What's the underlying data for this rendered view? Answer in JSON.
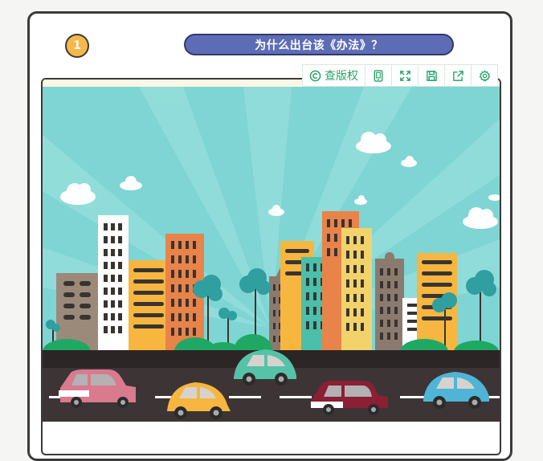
{
  "step": {
    "number": "1"
  },
  "header": {
    "title": "为什么出台该《办法》？"
  },
  "toolbar": {
    "copyright_label": "查版权",
    "icons": [
      "copyright-icon",
      "phone-preview-icon",
      "fullscreen-icon",
      "save-icon",
      "share-icon",
      "settings-icon"
    ]
  },
  "colors": {
    "badge": "#f7b84a",
    "title_pill": "#5d6db5",
    "toolbar_accent": "#2aa36b",
    "sky": "#7ed5d3",
    "road": "#3a3232"
  }
}
